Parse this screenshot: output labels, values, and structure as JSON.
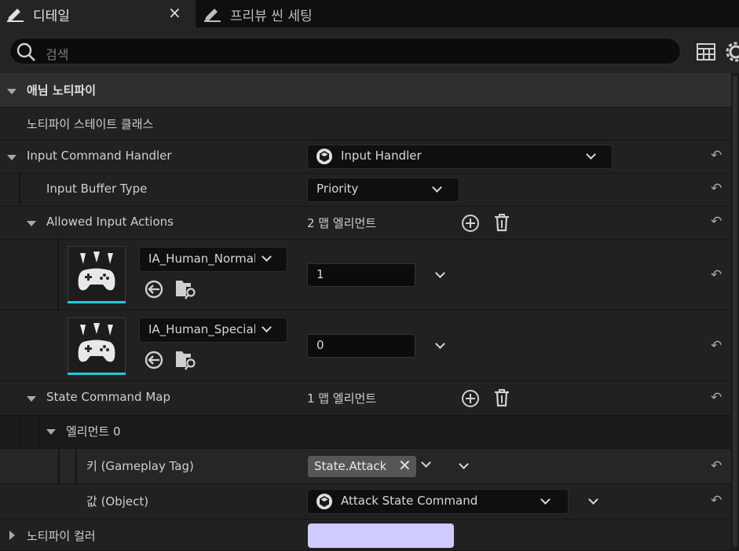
{
  "tabs": [
    {
      "label": "디테일",
      "close": "×"
    },
    {
      "label": "프리뷰 씬 세팅"
    }
  ],
  "search": {
    "placeholder": "검색"
  },
  "category": {
    "label": "애님 노티파이"
  },
  "rows": {
    "notify_state_class": {
      "label": "노티파이 스테이트 클래스"
    },
    "input_command_handler": {
      "label": "Input Command Handler",
      "value": "Input Handler"
    },
    "input_buffer_type": {
      "label": "Input Buffer Type",
      "value": "Priority"
    },
    "allowed_input_actions": {
      "label": "Allowed Input Actions",
      "count": "2 맵 엘리먼트"
    },
    "action_1": {
      "asset": "IA_Human_Normal",
      "value": "1"
    },
    "action_2": {
      "asset": "IA_Human_Special",
      "value": "0"
    },
    "state_command_map": {
      "label": "State Command Map",
      "count": "1 맵 엘리먼트"
    },
    "element0": {
      "label": "엘리먼트 0"
    },
    "key": {
      "label": "키 (Gameplay Tag)",
      "tag": "State.Attack"
    },
    "value": {
      "label": "값 (Object)",
      "value": "Attack State Command"
    },
    "notify_color": {
      "label": "노티파이 컬러",
      "color": "#cfcbff"
    }
  },
  "colors": {
    "accent_underline": "#27c7d8",
    "background": "#151515"
  }
}
